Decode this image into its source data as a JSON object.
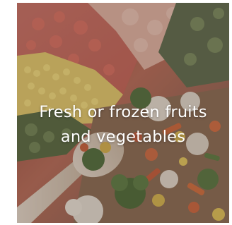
{
  "card": {
    "caption_line1": "Fresh or frozen fruits",
    "caption_line2": "and vegetables",
    "overlay_color": "#463732",
    "text_color": "#ffffff"
  },
  "photo": {
    "subject": "frozen mixed vegetables in plastic bags and on a wooden spoon"
  }
}
